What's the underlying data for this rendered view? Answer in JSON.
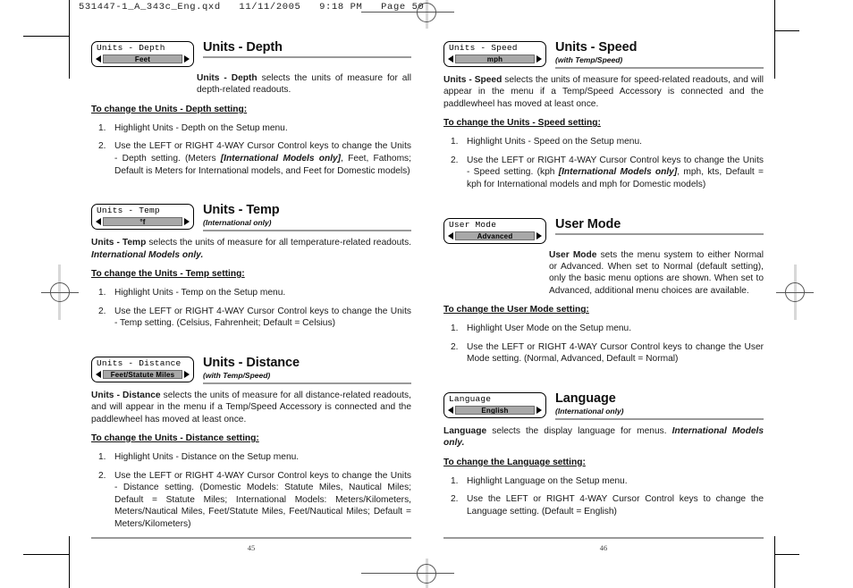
{
  "file_header": "531447-1_A_343c_Eng.qxd   11/11/2005   9:18 PM   Page 50",
  "left_page": {
    "page_number": "45",
    "sections": [
      {
        "widget": {
          "title": "Units - Depth",
          "value": "Feet"
        },
        "heading": "Units - Depth",
        "subheading": "",
        "body_prefix": "Units - Depth",
        "body": " selects the units of measure for all depth-related readouts.",
        "body_indented": true,
        "todo": "To change the Units - Depth setting:",
        "steps": [
          {
            "text_before": "Highlight Units - Depth on the Setup menu.",
            "italic": "",
            "text_after": ""
          },
          {
            "text_before": "Use the LEFT or RIGHT 4-WAY Cursor Control keys to change the Units - Depth setting. (Meters ",
            "italic": "[International Models only]",
            "text_after": ", Feet, Fathoms; Default is Meters for International models, and Feet for Domestic models)"
          }
        ]
      },
      {
        "widget": {
          "title": "Units - Temp",
          "value": "°f"
        },
        "heading": "Units - Temp",
        "subheading": "(International only)",
        "body_prefix": "Units - Temp",
        "body": " selects the units of measure for all temperature-related readouts. ",
        "body_italic_tail": "International Models only.",
        "body_indented": false,
        "todo": "To change the Units - Temp setting:",
        "steps": [
          {
            "text_before": "Highlight Units - Temp on the Setup menu.",
            "italic": "",
            "text_after": ""
          },
          {
            "text_before": "Use the LEFT or RIGHT 4-WAY Cursor Control keys to change the Units - Temp setting. (Celsius, Fahrenheit; Default = Celsius)",
            "italic": "",
            "text_after": ""
          }
        ]
      },
      {
        "widget": {
          "title": "Units - Distance",
          "value": "Feet/Statute Miles"
        },
        "heading": "Units - Distance",
        "subheading": "(with Temp/Speed)",
        "body_prefix": "Units - Distance",
        "body": " selects the units of measure for all distance-related readouts, and will appear in the menu if a Temp/Speed Accessory is connected and the paddlewheel has moved at least once.",
        "body_indented": false,
        "todo": "To change the Units - Distance setting:",
        "steps": [
          {
            "text_before": "Highlight Units - Distance on the Setup menu.",
            "italic": "",
            "text_after": ""
          },
          {
            "text_before": "Use the LEFT or RIGHT 4-WAY Cursor Control keys to change the Units - Distance setting. (Domestic Models: Statute Miles, Nautical Miles; Default = Statute Miles; International Models: Meters/Kilometers, Meters/Nautical Miles, Feet/Statute Miles, Feet/Nautical Miles; Default = Meters/Kilometers)",
            "italic": "",
            "text_after": ""
          }
        ]
      }
    ]
  },
  "right_page": {
    "page_number": "46",
    "sections": [
      {
        "widget": {
          "title": "Units - Speed",
          "value": "mph"
        },
        "heading": "Units - Speed",
        "subheading": "(with Temp/Speed)",
        "body_prefix": "Units - Speed",
        "body": " selects the units of measure for speed-related readouts, and will appear in the menu if a Temp/Speed Accessory is connected and the paddlewheel has moved at least once.",
        "body_indented": false,
        "todo": "To change the Units - Speed setting:",
        "steps": [
          {
            "text_before": "Highlight Units - Speed on the Setup menu.",
            "italic": "",
            "text_after": ""
          },
          {
            "text_before": "Use the LEFT or RIGHT 4-WAY Cursor Control keys to change the Units - Speed setting. (kph ",
            "italic": "[International Models only]",
            "text_after": ", mph, kts, Default = kph for International models and mph for Domestic models)"
          }
        ]
      },
      {
        "widget": {
          "title": "User Mode",
          "value": "Advanced"
        },
        "heading": "User Mode",
        "subheading": "",
        "body_prefix": "User Mode",
        "body": " sets the menu system to either Normal or Advanced. When set to Normal (default setting), only the basic menu options are shown.  When set to Advanced, additional menu choices are available.",
        "body_indented": true,
        "todo": "To change the User Mode setting:",
        "steps": [
          {
            "text_before": "Highlight User Mode on the Setup menu.",
            "italic": "",
            "text_after": ""
          },
          {
            "text_before": "Use the LEFT or RIGHT 4-WAY Cursor Control keys to change the User Mode setting. (Normal, Advanced, Default = Normal)",
            "italic": "",
            "text_after": ""
          }
        ]
      },
      {
        "widget": {
          "title": "Language",
          "value": "English"
        },
        "heading": "Language",
        "subheading": "(International only)",
        "body_prefix": "Language",
        "body": " selects the display language for menus. ",
        "body_italic_tail": "International Models only.",
        "body_indented": false,
        "todo": "To change the Language setting:",
        "steps": [
          {
            "text_before": "Highlight Language on the Setup menu.",
            "italic": "",
            "text_after": ""
          },
          {
            "text_before": "Use the LEFT or RIGHT 4-WAY Cursor Control keys to change the Language setting. (Default = English)",
            "italic": "",
            "text_after": ""
          }
        ]
      }
    ]
  }
}
